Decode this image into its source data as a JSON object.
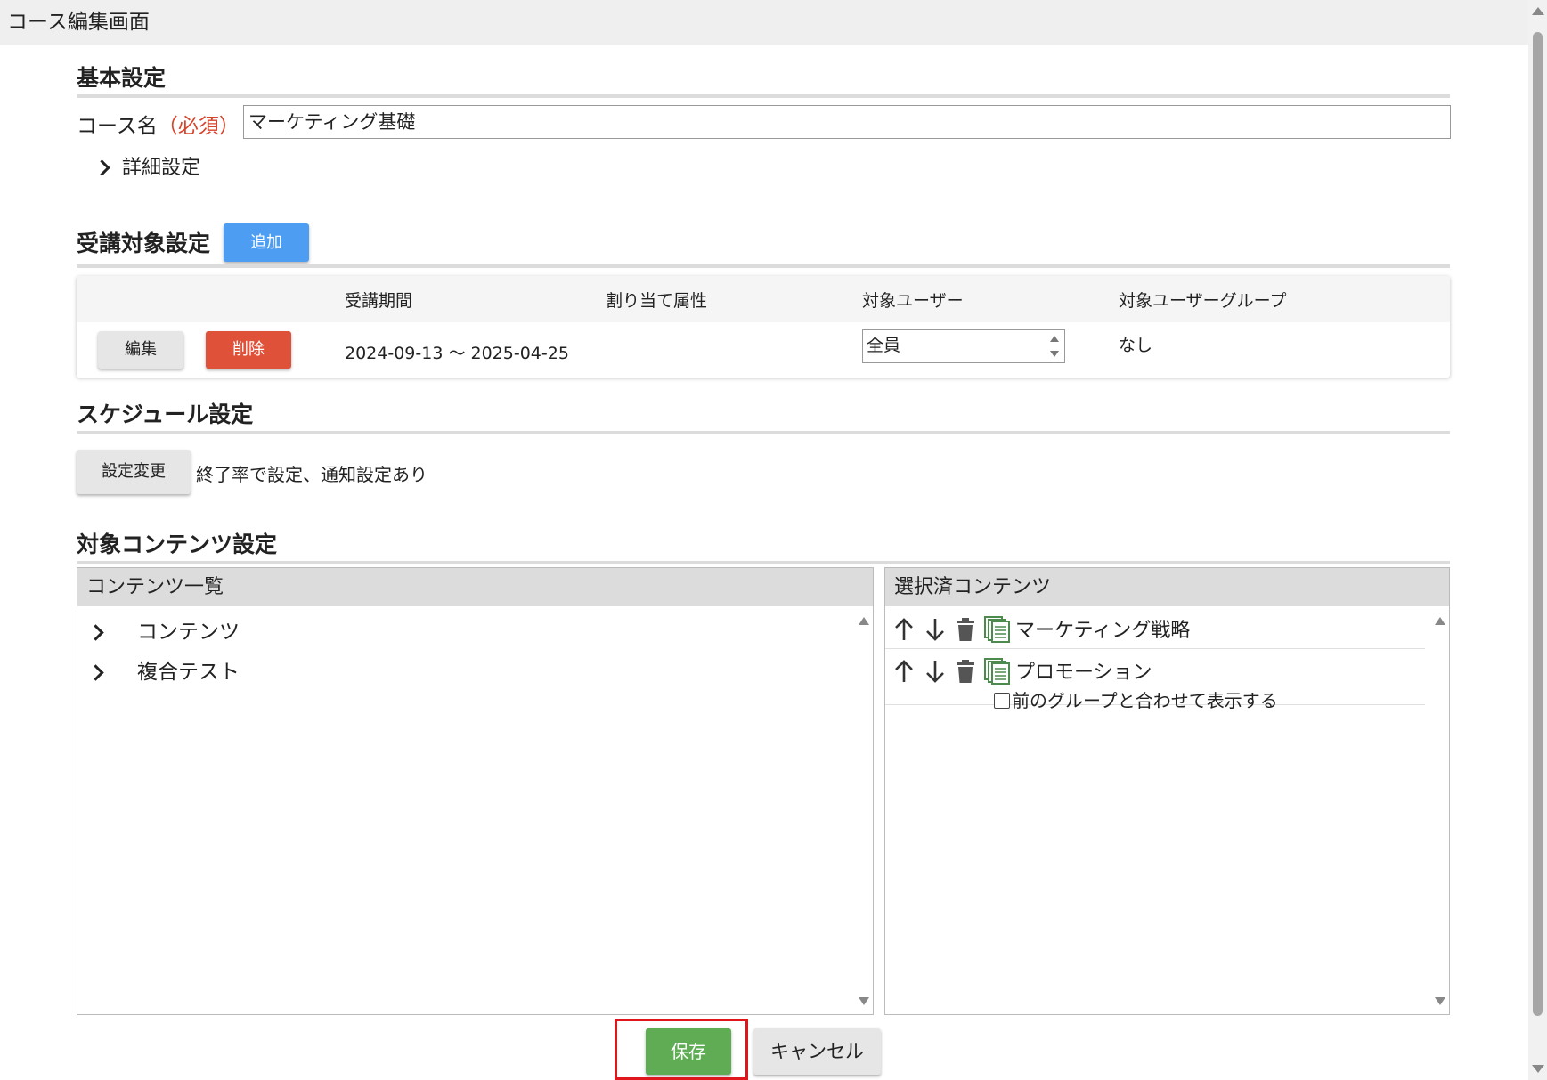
{
  "window": {
    "title": "コース編集画面"
  },
  "basic": {
    "title": "基本設定",
    "course_name_label": "コース名",
    "required_label": "（必須）",
    "course_name_value": "マーケティング基礎",
    "detail_toggle": "詳細設定"
  },
  "target": {
    "title": "受講対象設定",
    "add_button": "追加",
    "columns": [
      "受講期間",
      "割り当て属性",
      "対象ユーザー",
      "対象ユーザーグループ"
    ],
    "row": {
      "edit_button": "編集",
      "delete_button": "削除",
      "period": "2024-09-13 ～ 2025-04-25",
      "attribute": "",
      "user": "全員",
      "user_group": "なし"
    }
  },
  "schedule": {
    "title": "スケジュール設定",
    "change_button": "設定変更",
    "status_text": "終了率で設定、通知設定あり"
  },
  "contents": {
    "title": "対象コンテンツ設定",
    "list_header": "コンテンツ一覧",
    "list_items": [
      "コンテンツ",
      "複合テスト"
    ],
    "selected_header": "選択済コンテンツ",
    "selected_items": [
      {
        "label": "マーケティング戦略"
      },
      {
        "label": "プロモーション",
        "checkbox_label": "前のグループと合わせて表示する"
      }
    ]
  },
  "footer": {
    "save_button": "保存",
    "cancel_button": "キャンセル"
  },
  "colors": {
    "accent_blue": "#4d9df3",
    "danger_red": "#e0513a",
    "save_green": "#5fac54",
    "required_red": "#d8432b",
    "highlight": "#e0161d"
  }
}
